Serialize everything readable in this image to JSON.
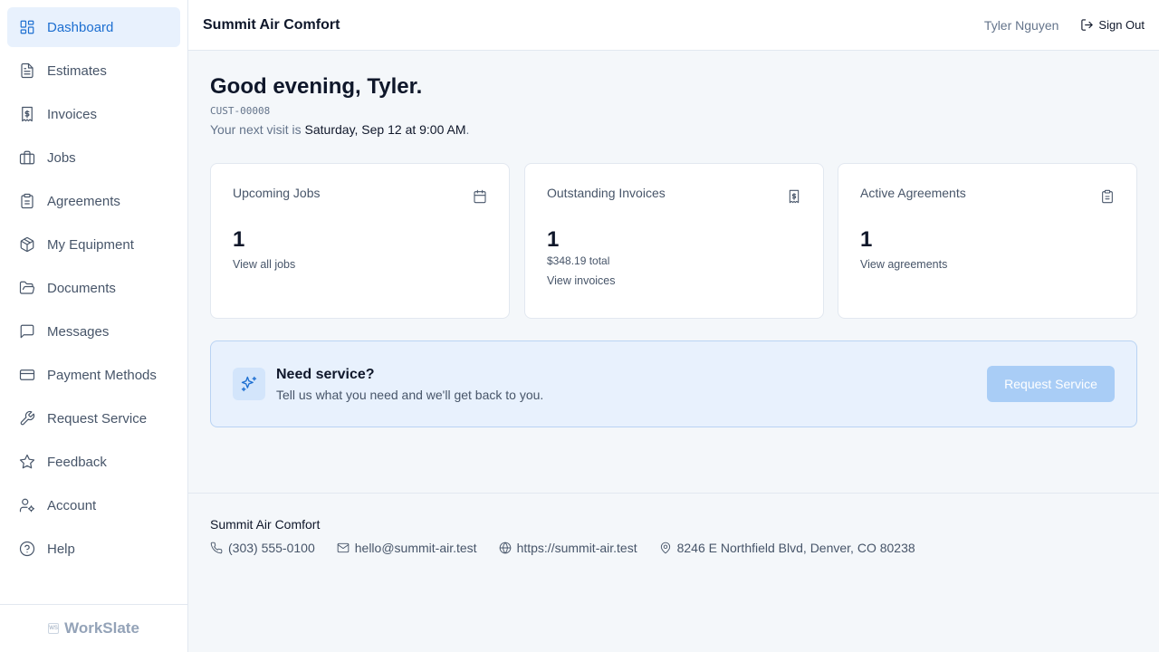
{
  "sidebar": {
    "items": [
      {
        "label": "Dashboard",
        "icon": "dashboard-icon",
        "active": true
      },
      {
        "label": "Estimates",
        "icon": "file-text-icon"
      },
      {
        "label": "Invoices",
        "icon": "receipt-dollar-icon"
      },
      {
        "label": "Jobs",
        "icon": "briefcase-icon"
      },
      {
        "label": "Agreements",
        "icon": "clipboard-icon"
      },
      {
        "label": "My Equipment",
        "icon": "package-icon"
      },
      {
        "label": "Documents",
        "icon": "folder-icon"
      },
      {
        "label": "Messages",
        "icon": "message-square-icon"
      },
      {
        "label": "Payment Methods",
        "icon": "credit-card-icon"
      },
      {
        "label": "Request Service",
        "icon": "wrench-icon"
      },
      {
        "label": "Feedback",
        "icon": "star-icon"
      },
      {
        "label": "Account",
        "icon": "user-cog-icon"
      },
      {
        "label": "Help",
        "icon": "help-circle-icon"
      }
    ],
    "brand": "WorkSlate",
    "brand_mark": "WS"
  },
  "header": {
    "company": "Summit Air Comfort",
    "user_name": "Tyler Nguyen",
    "sign_out": "Sign Out"
  },
  "main": {
    "greeting": "Good evening, Tyler.",
    "customer_id": "CUST-00008",
    "next_visit_prefix": "Your next visit is ",
    "next_visit_date": "Saturday, Sep 12 at 9:00 AM",
    "next_visit_suffix": "."
  },
  "cards": [
    {
      "title": "Upcoming Jobs",
      "count": "1",
      "link": "View all jobs",
      "icon": "calendar-icon"
    },
    {
      "title": "Outstanding Invoices",
      "count": "1",
      "sub": "$348.19 total",
      "link": "View invoices",
      "icon": "receipt-dollar-icon"
    },
    {
      "title": "Active Agreements",
      "count": "1",
      "link": "View agreements",
      "icon": "clipboard-icon"
    }
  ],
  "cta": {
    "title": "Need service?",
    "subtitle": "Tell us what you need and we'll get back to you.",
    "button": "Request Service",
    "icon": "sparkles-icon"
  },
  "footer": {
    "company": "Summit Air Comfort",
    "phone": "(303) 555-0100",
    "email": "hello@summit-air.test",
    "website": "https://summit-air.test",
    "address": "8246 E Northfield Blvd, Denver, CO 80238"
  },
  "colors": {
    "accent": "#1d6fd1",
    "active_bg": "#e8f1fd",
    "cta_button": "#a9cdf6",
    "page_bg": "#f4f7fa"
  }
}
